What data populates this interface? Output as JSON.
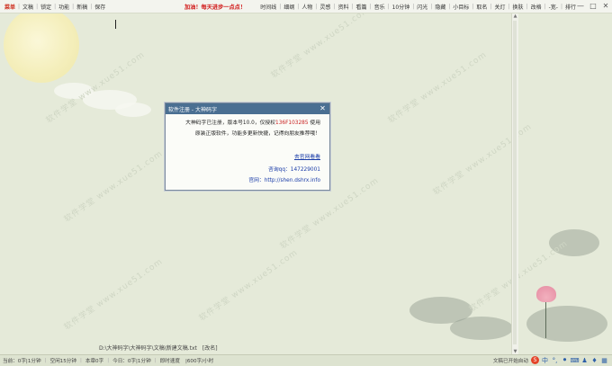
{
  "topbar": {
    "left_items": [
      {
        "label": "菜单",
        "style": "red"
      },
      {
        "label": "文稿"
      },
      {
        "label": "锁定"
      },
      {
        "label": "功能"
      },
      {
        "label": "新稿"
      },
      {
        "label": "保存"
      }
    ],
    "slogan": "加油！每天进步一点点！",
    "right_items": [
      "时间线",
      "细纲",
      "人物",
      "灵感",
      "资料",
      "看篇",
      "音乐",
      "10分钟",
      "闪光",
      "隐藏",
      "小目标",
      "取名",
      "关灯",
      "换肤",
      "改格",
      "-宽-",
      "排行"
    ],
    "window_controls": {
      "minimize": "—",
      "maximize": "□",
      "close": "✕"
    }
  },
  "dialog": {
    "title": "软件注册 - 大神码字",
    "close": "✕",
    "line1_prefix": "大神码字已注册，版本号10.0，仅授权",
    "line1_code": "136F103285",
    "line1_suffix": " 使用",
    "line2": "原装正版软件，功能多更新快捷，记得向朋友推荐哦！",
    "link": "去官网看看",
    "qq": "咨询qq：147229001",
    "site": "官网：http://shen.dshrx.info"
  },
  "path_row": {
    "path": "D:\\大神码字\\大神码字\\文稿\\新建文稿.txt",
    "tag": "[改名]"
  },
  "statusbar": {
    "segments": [
      "当前：0字|1分钟",
      "空闲15分钟",
      "本章0字",
      "今日：0字|1分钟",
      "即时速度",
      "|600字/小时"
    ],
    "right_text": "文稿已开始自动",
    "tray_icons": [
      {
        "name": "ime-s-icon",
        "glyph": "S"
      },
      {
        "name": "chinese-input-icon",
        "glyph": "中"
      },
      {
        "name": "punctuation-icon",
        "glyph": "°,"
      },
      {
        "name": "mic-icon",
        "glyph": "⏺"
      },
      {
        "name": "keyboard-icon",
        "glyph": "⌨"
      },
      {
        "name": "person-icon",
        "glyph": "♟"
      },
      {
        "name": "shirt-icon",
        "glyph": "♦"
      },
      {
        "name": "grid-icon",
        "glyph": "▦"
      }
    ]
  },
  "watermark": "软件学堂 www.xue51.com",
  "colors": {
    "accent": "#4a6f92",
    "red": "#cc2a1a",
    "link": "#1a3ca8",
    "bg": "#e5ead9"
  }
}
